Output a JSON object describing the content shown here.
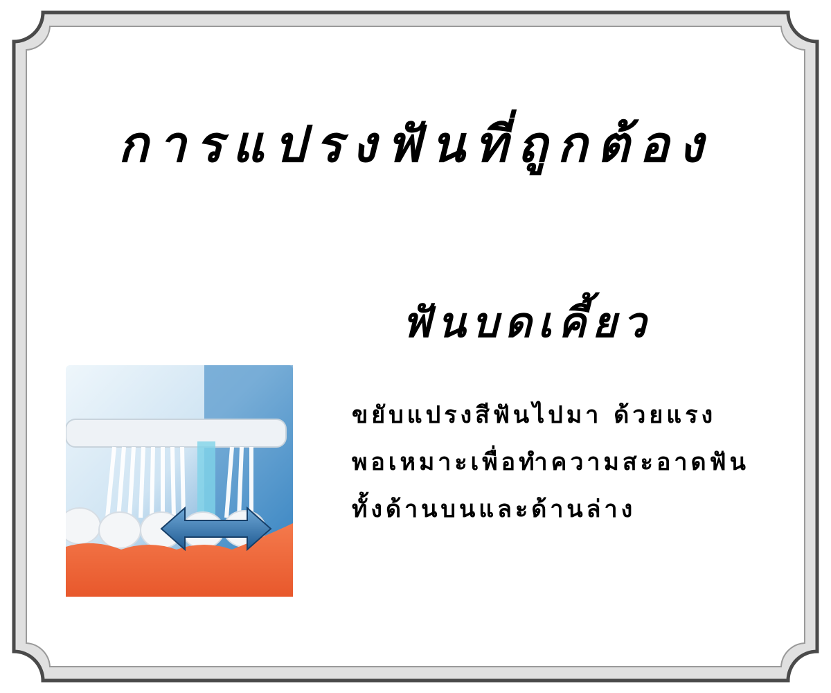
{
  "title": "การแปรงฟันที่ถูกต้อง",
  "subtitle": "ฟันบดเคี้ยว",
  "instruction_lines": [
    "ขยับแปรงสีฟันไปมา ด้วยแรง",
    "พอเหมาะเพื่อทำความสะอาดฟัน",
    "ทั้งด้านบนและด้านล่าง"
  ],
  "illustration": {
    "depicts": "toothbrush-on-molars",
    "colors": {
      "background_top": "#2f7fc0",
      "background_light": "#dfeef8",
      "gum": "#f06a3c",
      "arrow": "#2e6fa8"
    }
  },
  "frame": {
    "border_color": "#4a4a4a",
    "fill_color": "#e0e0e0"
  }
}
